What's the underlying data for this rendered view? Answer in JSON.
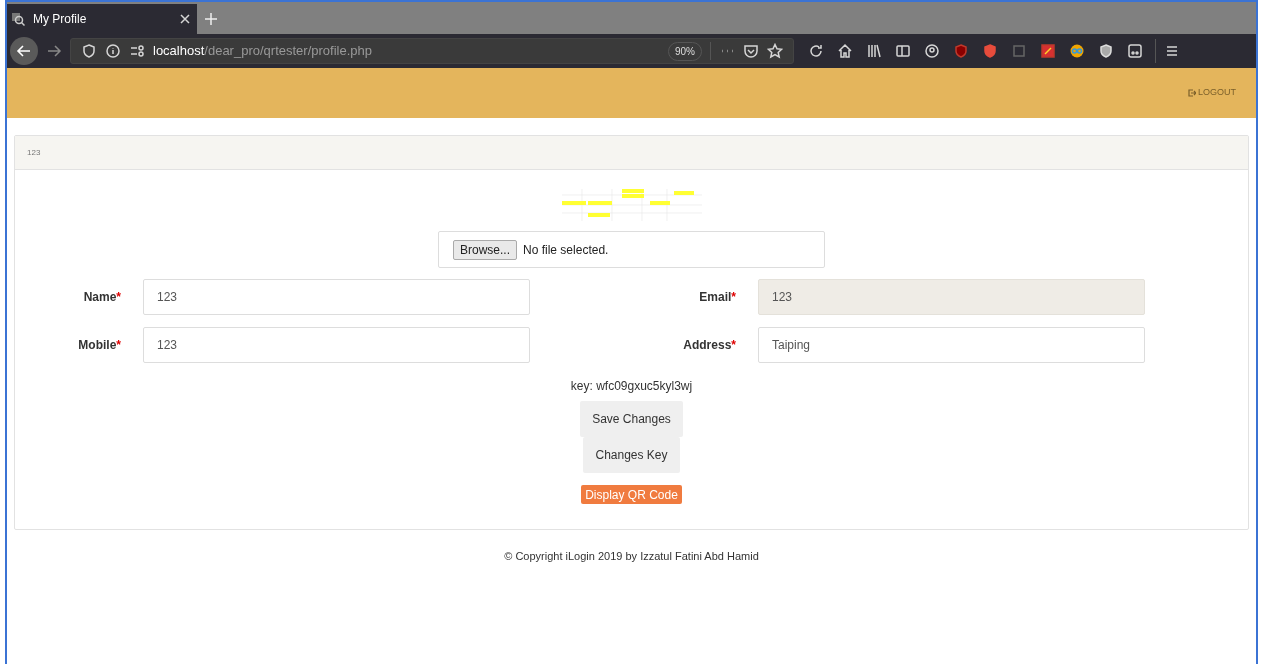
{
  "browser": {
    "tab_title": "My Profile",
    "url_host": "localhost",
    "url_path": "/dear_pro/qrtester/profile.php",
    "zoom": "90%"
  },
  "header": {
    "logout": "LOGOUT"
  },
  "panel": {
    "title": "123"
  },
  "upload": {
    "button": "Browse...",
    "status": "No file selected."
  },
  "fields": [
    {
      "label": "Name",
      "required_mark": "*",
      "value": "123",
      "disabled": false
    },
    {
      "label": "Email",
      "required_mark": "*",
      "value": "123",
      "disabled": true
    },
    {
      "label": "Mobile",
      "required_mark": "*",
      "value": "123",
      "disabled": false
    },
    {
      "label": "Address",
      "required_mark": "*",
      "value": "Taiping",
      "disabled": false
    }
  ],
  "key": "key: wfc09gxuc5kyl3wj",
  "buttons": [
    {
      "label": "Save Changes",
      "kind": "plain"
    },
    {
      "label": "Changes Key",
      "kind": "plain"
    },
    {
      "label": "Display QR Code",
      "kind": "accent"
    }
  ],
  "footer": "© Copyright iLogin 2019 by Izzatul Fatini Abd Hamid"
}
